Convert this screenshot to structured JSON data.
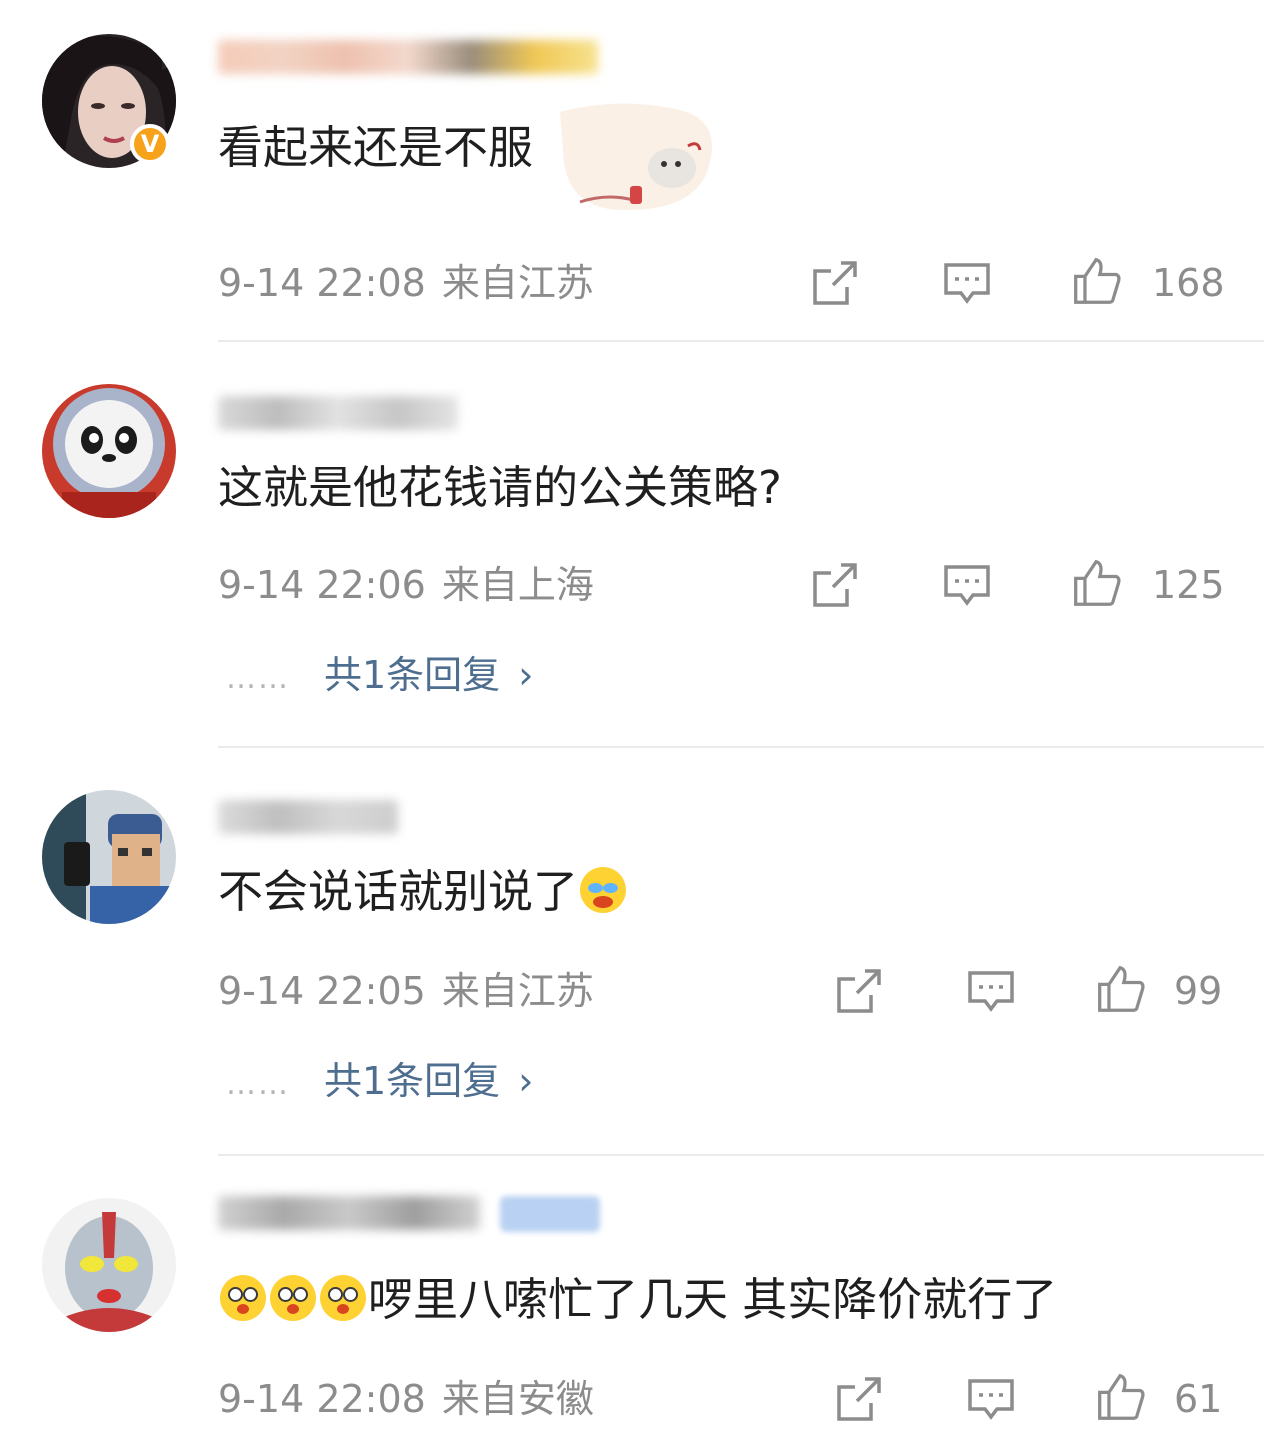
{
  "comments": [
    {
      "text": "看起来还是不服",
      "time": "9-14 22:08",
      "location": "来自江苏",
      "likes": "168",
      "avatar_icon": "woman-portrait-avatar",
      "verified": true
    },
    {
      "text": "这就是他花钱请的公关策略?",
      "time": "9-14 22:06",
      "location": "来自上海",
      "likes": "125",
      "replies": "共1条回复",
      "avatar_icon": "panda-astronaut-avatar"
    },
    {
      "text": "不会说话就别说了",
      "time": "9-14 22:05",
      "location": "来自江苏",
      "likes": "99",
      "replies": "共1条回复",
      "avatar_icon": "cartoon-man-avatar",
      "emoji": "laughing-crying-emoji"
    },
    {
      "text": "啰里八嗦忙了几天 其实降价就行了",
      "time": "9-14 22:08",
      "location": "来自安徽",
      "likes": "61",
      "avatar_icon": "ultraman-avatar",
      "emoji": "shocked-emoji"
    }
  ],
  "colors": {
    "meta": "#8c8c8c",
    "link": "#4e6e8f",
    "verified": "#f7a21b"
  }
}
